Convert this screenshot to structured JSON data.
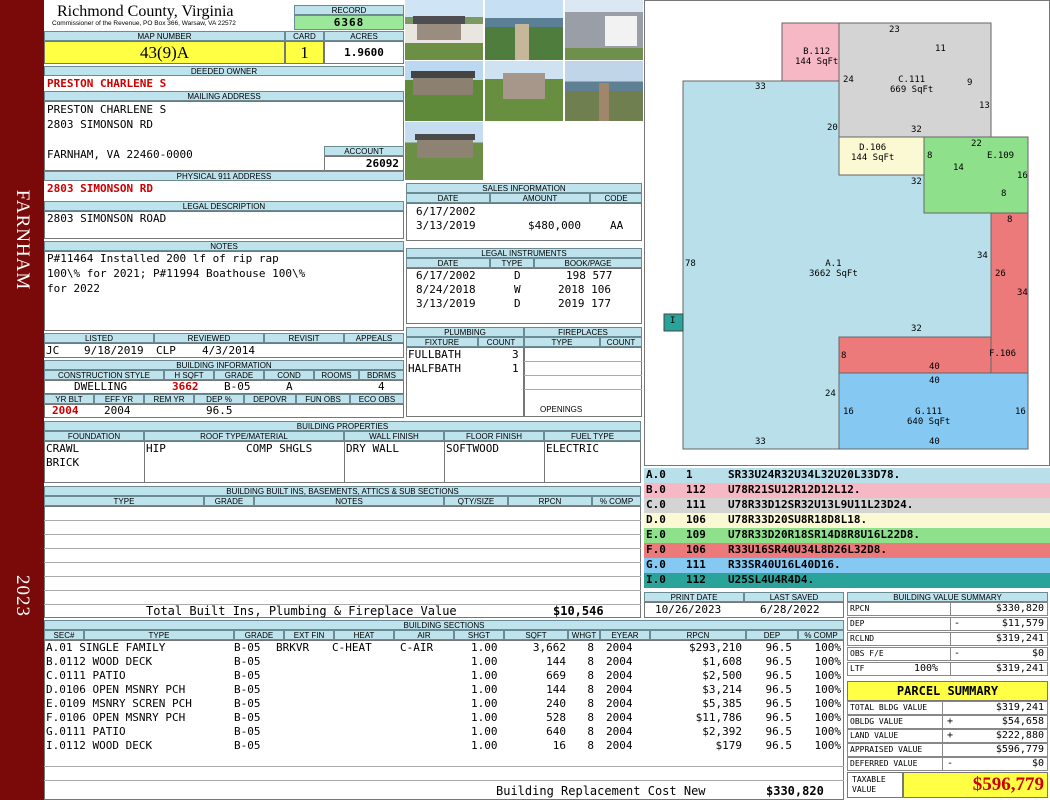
{
  "sidebar": {
    "district": "FARNHAM",
    "year": "2023"
  },
  "header": {
    "county": "Richmond County, Virginia",
    "commissioner": "Commissioner of the Revenue, PO Box 366, Warsaw, VA 22572",
    "record_label": "RECORD",
    "record": "6368",
    "map_label": "MAP NUMBER",
    "map_number": "43(9)A",
    "card_label": "CARD",
    "card": "1",
    "acres_label": "ACRES",
    "acres": "1.9600"
  },
  "owner": {
    "deeded_label": "DEEDED OWNER",
    "name": "PRESTON CHARLENE S",
    "mailing_label": "MAILING ADDRESS",
    "mail_line1": "PRESTON CHARLENE S",
    "mail_line2": "2803 SIMONSON RD",
    "mail_line3": "",
    "mail_line4": "FARNHAM, VA 22460-0000",
    "account_label": "ACCOUNT",
    "account": "26092",
    "physical_label": "PHYSICAL 911 ADDRESS",
    "physical": "2803 SIMONSON RD",
    "legal_label": "LEGAL DESCRIPTION",
    "legal": "2803 SIMONSON ROAD",
    "notes_label": "NOTES",
    "notes_line1": "P#11464 Installed 200 lf of rip rap",
    "notes_line2": "100\\% for 2021; P#11994 Boathouse 100\\%",
    "notes_line3": "for 2022"
  },
  "listing": {
    "listed_label": "LISTED",
    "reviewed_label": "REVIEWED",
    "revisit_label": "REVISIT",
    "appeals_label": "APPEALS",
    "listed_by": "JC",
    "listed_date": "9/18/2019",
    "reviewed_by": "CLP",
    "reviewed_date": "4/3/2014"
  },
  "building_info": {
    "label": "BUILDING INFORMATION",
    "headers": [
      "CONSTRUCTION STYLE",
      "H SQFT",
      "GRADE",
      "COND",
      "ROOMS",
      "BDRMS"
    ],
    "style": "DWELLING",
    "hsqft": "3662",
    "grade": "B-05",
    "cond": "A",
    "rooms": "",
    "bdrms": "4",
    "headers2": [
      "YR BLT",
      "EFF YR",
      "REM YR",
      "DEP %",
      "DEPOVR",
      "FUN OBS",
      "ECO OBS"
    ],
    "yr_blt": "2004",
    "eff_yr": "2004",
    "rem_yr": "",
    "dep": "96.5"
  },
  "properties": {
    "label": "BUILDING PROPERTIES",
    "headers": [
      "FOUNDATION",
      "ROOF TYPE/MATERIAL",
      "WALL FINISH",
      "FLOOR FINISH",
      "FUEL TYPE"
    ],
    "foundation1": "CRAWL",
    "foundation2": "BRICK",
    "roof_type": "HIP",
    "roof_mat": "COMP SHGLS",
    "wall": "DRY WALL",
    "floor": "SOFTWOOD",
    "fuel": "ELECTRIC"
  },
  "builtins": {
    "label": "BUILDING BUILT INS, BASEMENTS, ATTICS & SUB SECTIONS",
    "headers": [
      "TYPE",
      "GRADE",
      "NOTES",
      "QTY/SIZE",
      "RPCN",
      "% COMP"
    ],
    "total_label": "Total Built Ins, Plumbing & Fireplace Value",
    "total": "$10,546"
  },
  "sales": {
    "label": "SALES INFORMATION",
    "headers": [
      "DATE",
      "AMOUNT",
      "CODE"
    ],
    "rows": [
      {
        "date": "6/17/2002",
        "amount": "",
        "code": ""
      },
      {
        "date": "3/13/2019",
        "amount": "$480,000",
        "code": "AA"
      }
    ]
  },
  "instruments": {
    "label": "LEGAL INSTRUMENTS",
    "headers": [
      "DATE",
      "TYPE",
      "BOOK/PAGE"
    ],
    "rows": [
      {
        "date": "6/17/2002",
        "type": "D",
        "book": "198 577"
      },
      {
        "date": "8/24/2018",
        "type": "W",
        "book": "2018 106"
      },
      {
        "date": "3/13/2019",
        "type": "D",
        "book": "2019 177"
      }
    ]
  },
  "plumbing": {
    "label": "PLUMBING",
    "headers": [
      "FIXTURE",
      "COUNT"
    ],
    "rows": [
      {
        "fixture": "FULLBATH",
        "count": "3"
      },
      {
        "fixture": "HALFBATH",
        "count": "1"
      }
    ]
  },
  "fireplaces": {
    "label": "FIREPLACES",
    "headers": [
      "TYPE",
      "COUNT"
    ],
    "openings_label": "OPENINGS"
  },
  "sketch": {
    "areas": [
      {
        "code": "A.1",
        "sqft": "3662 SqFt"
      },
      {
        "code": "B.112",
        "sqft": "144 SqFt"
      },
      {
        "code": "C.111",
        "sqft": "669 SqFt"
      },
      {
        "code": "D.106",
        "sqft": "144 SqFt"
      },
      {
        "code": "E.109",
        "sqft": ""
      },
      {
        "code": "F.106",
        "sqft": ""
      },
      {
        "code": "G.111",
        "sqft": "640 SqFt"
      },
      {
        "code": "I",
        "sqft": ""
      }
    ],
    "dims": [
      "23",
      "11",
      "9",
      "13",
      "32",
      "24",
      "20",
      "33",
      "22",
      "8",
      "14",
      "16",
      "8",
      "8",
      "78",
      "34",
      "26",
      "34",
      "32",
      "32",
      "8",
      "40",
      "40",
      "24",
      "16",
      "16",
      "33",
      "40"
    ]
  },
  "legend": [
    {
      "sec": "A.0",
      "code": "1",
      "desc": "SR33U24R32U34L32U20L33D78.",
      "color": "#b9e0ea"
    },
    {
      "sec": "B.0",
      "code": "112",
      "desc": "U78R21SU12R12D12L12.",
      "color": "#f7b8c6"
    },
    {
      "sec": "C.0",
      "code": "111",
      "desc": "U78R33D12SR32U13L9U11L23D24.",
      "color": "#d4d4d4"
    },
    {
      "sec": "D.0",
      "code": "106",
      "desc": "U78R33D20SU8R18D8L18.",
      "color": "#fbf8d4"
    },
    {
      "sec": "E.0",
      "code": "109",
      "desc": "U78R33D20R18SR14D8R8U16L22D8.",
      "color": "#8fe08a"
    },
    {
      "sec": "F.0",
      "code": "106",
      "desc": "R33U16SR40U34L8D26L32D8.",
      "color": "#ec7a7a"
    },
    {
      "sec": "G.0",
      "code": "111",
      "desc": "R33SR40U16L40D16.",
      "color": "#85c8f2"
    },
    {
      "sec": "I.0",
      "code": "112",
      "desc": "U25SL4U4R4D4.",
      "color": "#2aa39a"
    }
  ],
  "dates": {
    "print_label": "PRINT DATE",
    "last_label": "LAST SAVED",
    "print_date": "10/26/2023",
    "last_saved": "6/28/2022"
  },
  "sections": {
    "label": "BUILDING SECTIONS",
    "headers": [
      "SEC#",
      "TYPE",
      "GRADE",
      "EXT FIN",
      "HEAT",
      "AIR",
      "SHGT",
      "SQFT",
      "WHGT",
      "EYEAR",
      "RPCN",
      "DEP",
      "% COMP"
    ],
    "rows": [
      {
        "sec": "A.0",
        "type": "1 SINGLE FAMILY",
        "grade": "B-05",
        "ext": "BRKVR",
        "heat": "C-HEAT",
        "air": "C-AIR",
        "shgt": "1.00",
        "sqft": "3,662",
        "whgt": "8",
        "eyear": "2004",
        "rpcn": "$293,210",
        "dep": "96.5",
        "comp": "100%"
      },
      {
        "sec": "B.0",
        "type": "112 WOOD DECK",
        "grade": "B-05",
        "ext": "",
        "heat": "",
        "air": "",
        "shgt": "1.00",
        "sqft": "144",
        "whgt": "8",
        "eyear": "2004",
        "rpcn": "$1,608",
        "dep": "96.5",
        "comp": "100%"
      },
      {
        "sec": "C.0",
        "type": "111 PATIO",
        "grade": "B-05",
        "ext": "",
        "heat": "",
        "air": "",
        "shgt": "1.00",
        "sqft": "669",
        "whgt": "8",
        "eyear": "2004",
        "rpcn": "$2,500",
        "dep": "96.5",
        "comp": "100%"
      },
      {
        "sec": "D.0",
        "type": "106 OPEN MSNRY PCH",
        "grade": "B-05",
        "ext": "",
        "heat": "",
        "air": "",
        "shgt": "1.00",
        "sqft": "144",
        "whgt": "8",
        "eyear": "2004",
        "rpcn": "$3,214",
        "dep": "96.5",
        "comp": "100%"
      },
      {
        "sec": "E.0",
        "type": "109 MSNRY SCREN PCH",
        "grade": "B-05",
        "ext": "",
        "heat": "",
        "air": "",
        "shgt": "1.00",
        "sqft": "240",
        "whgt": "8",
        "eyear": "2004",
        "rpcn": "$5,385",
        "dep": "96.5",
        "comp": "100%"
      },
      {
        "sec": "F.0",
        "type": "106 OPEN MSNRY PCH",
        "grade": "B-05",
        "ext": "",
        "heat": "",
        "air": "",
        "shgt": "1.00",
        "sqft": "528",
        "whgt": "8",
        "eyear": "2004",
        "rpcn": "$11,786",
        "dep": "96.5",
        "comp": "100%"
      },
      {
        "sec": "G.0",
        "type": "111 PATIO",
        "grade": "B-05",
        "ext": "",
        "heat": "",
        "air": "",
        "shgt": "1.00",
        "sqft": "640",
        "whgt": "8",
        "eyear": "2004",
        "rpcn": "$2,392",
        "dep": "96.5",
        "comp": "100%"
      },
      {
        "sec": "I.0",
        "type": "112 WOOD DECK",
        "grade": "B-05",
        "ext": "",
        "heat": "",
        "air": "",
        "shgt": "1.00",
        "sqft": "16",
        "whgt": "8",
        "eyear": "2004",
        "rpcn": "$179",
        "dep": "96.5",
        "comp": "100%"
      }
    ],
    "replacement_label": "Building Replacement Cost New",
    "replacement": "$330,820"
  },
  "bvs": {
    "label": "BUILDING VALUE SUMMARY",
    "rows": [
      {
        "k": "RPCN",
        "s": "",
        "v": "$330,820"
      },
      {
        "k": "DEP",
        "s": "-",
        "v": "$11,579"
      },
      {
        "k": "RCLND",
        "s": "",
        "v": "$319,241"
      },
      {
        "k": "OBS F/E",
        "s": "-",
        "v": "$0"
      },
      {
        "k": "LTF",
        "p": "100%",
        "s": "",
        "v": "$319,241"
      }
    ]
  },
  "parcel": {
    "title": "PARCEL SUMMARY",
    "rows": [
      {
        "k": "TOTAL BLDG VALUE",
        "s": "",
        "v": "$319,241"
      },
      {
        "k": "OBLDG VALUE",
        "s": "+",
        "v": "$54,658"
      },
      {
        "k": "LAND VALUE",
        "s": "+",
        "v": "$222,880"
      },
      {
        "k": "APPRAISED VALUE",
        "s": "",
        "v": "$596,779"
      },
      {
        "k": "DEFERRED VALUE",
        "s": "-",
        "v": "$0"
      }
    ],
    "taxable_label1": "TAXABLE",
    "taxable_label2": "VALUE",
    "taxable": "$596,779"
  }
}
